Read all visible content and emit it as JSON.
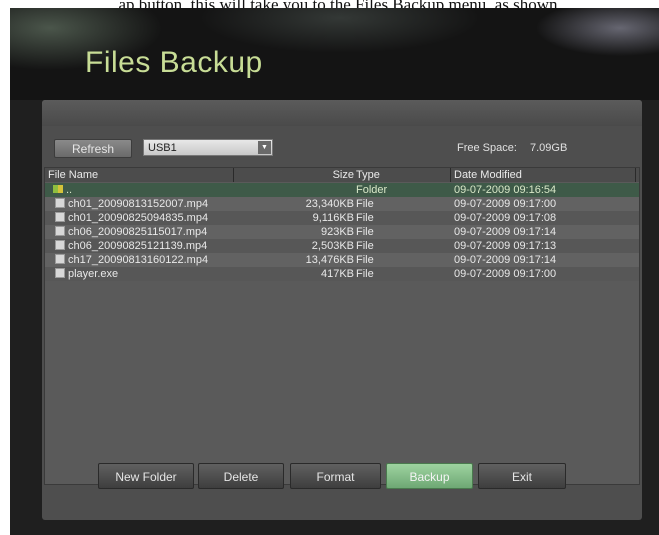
{
  "caption": "…ap button, this will take you to the Files Backup menu, as shown",
  "window": {
    "title": "Files Backup"
  },
  "toolbar": {
    "refresh_label": "Refresh",
    "device_selected": "USB1",
    "free_space_label": "Free Space:",
    "free_space_value": "7.09GB"
  },
  "table": {
    "columns": [
      "File Name",
      "Size",
      "Type",
      "Date Modified"
    ],
    "rows": [
      {
        "name": "..",
        "size": "",
        "type": "Folder",
        "date": "09-07-2009 09:16:54",
        "icon": "folder-up-icon"
      },
      {
        "name": "ch01_20090813152007.mp4",
        "size": "23,340KB",
        "type": "File",
        "date": "09-07-2009 09:17:00",
        "icon": "file-icon"
      },
      {
        "name": "ch01_20090825094835.mp4",
        "size": "9,116KB",
        "type": "File",
        "date": "09-07-2009 09:17:08",
        "icon": "file-icon"
      },
      {
        "name": "ch06_20090825115017.mp4",
        "size": "923KB",
        "type": "File",
        "date": "09-07-2009 09:17:14",
        "icon": "file-icon"
      },
      {
        "name": "ch06_20090825121139.mp4",
        "size": "2,503KB",
        "type": "File",
        "date": "09-07-2009 09:17:13",
        "icon": "file-icon"
      },
      {
        "name": "ch17_20090813160122.mp4",
        "size": "13,476KB",
        "type": "File",
        "date": "09-07-2009 09:17:14",
        "icon": "file-icon"
      },
      {
        "name": "player.exe",
        "size": "417KB",
        "type": "File",
        "date": "09-07-2009 09:17:00",
        "icon": "file-icon"
      }
    ]
  },
  "footer": {
    "new_folder_label": "New Folder",
    "delete_label": "Delete",
    "format_label": "Format",
    "backup_label": "Backup",
    "exit_label": "Exit"
  },
  "colors": {
    "title": "#c8dd96",
    "panel": "#4e4e4e",
    "backup_button": "#8cc790"
  }
}
